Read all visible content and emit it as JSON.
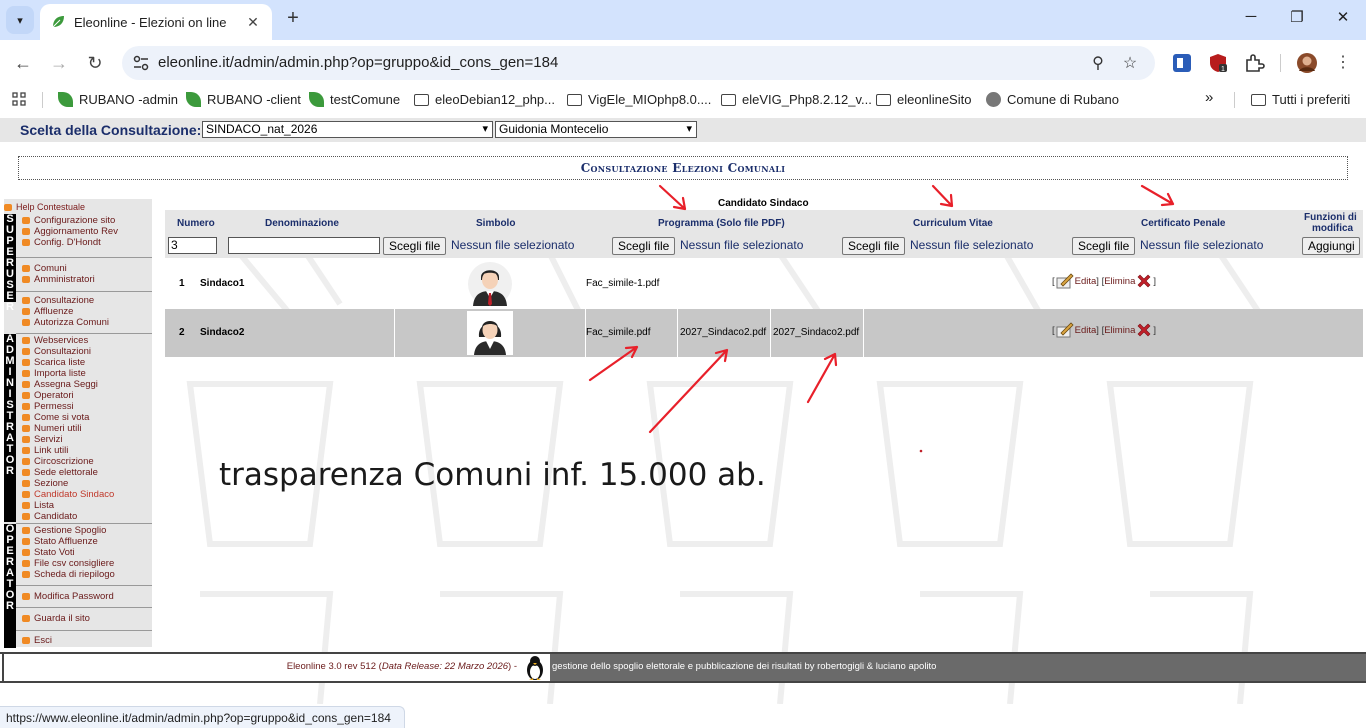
{
  "browser": {
    "tab_title": "Eleonline - Elezioni on line",
    "url": "eleonline.it/admin/admin.php?op=gruppo&id_cons_gen=184",
    "bookmarks": [
      {
        "label": "RUBANO -admin",
        "icon": "leaf-icon"
      },
      {
        "label": "RUBANO -client",
        "icon": "leaf-icon"
      },
      {
        "label": "testComune",
        "icon": "leaf-icon"
      },
      {
        "label": "eleoDebian12_php...",
        "icon": "folder-icon"
      },
      {
        "label": "VigEle_MIOphp8.0....",
        "icon": "folder-icon"
      },
      {
        "label": "eleVIG_Php8.2.12_v...",
        "icon": "folder-icon"
      },
      {
        "label": "eleonlineSito",
        "icon": "folder-icon"
      },
      {
        "label": "Comune di Rubano",
        "icon": "crest-icon"
      }
    ],
    "bookmarks_more": "»",
    "all_bookmarks": "Tutti i preferiti",
    "status_url": "https://www.eleonline.it/admin/admin.php?op=gruppo&id_cons_gen=184"
  },
  "consultation": {
    "label": "Scelta della Consultazione:",
    "selected": "SINDACO_nat_2026",
    "comune": "Guidonia Montecelio"
  },
  "page_title": "Consultazione Elezioni Comunali",
  "sidebar": {
    "help": "Help Contestuale",
    "bars": {
      "superuser": "SUPERUSER",
      "administrator": "ADMINISTRATOR",
      "operator": "OPERATOR"
    },
    "group1": [
      "Configurazione sito",
      "Aggiornamento Rev",
      "Config. D'Hondt"
    ],
    "group2": [
      "Comuni",
      "Amministratori"
    ],
    "group3": [
      "Consultazione",
      "Affluenze",
      "Autorizza Comuni"
    ],
    "group4": [
      "Webservices",
      "Consultazioni",
      "Scarica liste",
      "Importa liste",
      "Assegna Seggi",
      "Operatori",
      "Permessi",
      "Come si vota",
      "Numeri utili",
      "Servizi",
      "Link utili",
      "Circoscrizione",
      "Sede elettorale",
      "Sezione",
      "Candidato Sindaco",
      "Lista",
      "Candidato"
    ],
    "active_item": "Candidato Sindaco",
    "group5": [
      "Gestione Spoglio",
      "Stato Affluenze",
      "Stato Voti",
      "File csv consigliere",
      "Scheda di riepilogo"
    ],
    "password": "Modifica Password",
    "site": "Guarda il sito",
    "exit": "Esci"
  },
  "table": {
    "caption": "Candidato Sindaco",
    "headers": {
      "numero": "Numero",
      "denominazione": "Denominazione",
      "simbolo": "Simbolo",
      "programma": "Programma (Solo file PDF)",
      "curriculum": "Curriculum Vitae",
      "certificato": "Certificato Penale",
      "funzioni_1": "Funzioni di",
      "funzioni_2": "modifica"
    },
    "form": {
      "numero_value": "3",
      "denominazione_value": "",
      "choose_file": "Scegli file",
      "no_file": "Nessun file selezionato",
      "add_button": "Aggiungi"
    },
    "rows": [
      {
        "num": "1",
        "name": "Sindaco1",
        "avatar": "male-avatar-icon",
        "programma": "Fac_simile-1.pdf",
        "curriculum": "",
        "certificato": "",
        "edit": "Edita",
        "delete": "Elimina"
      },
      {
        "num": "2",
        "name": "Sindaco2",
        "avatar": "female-avatar-icon",
        "programma": "Fac_simile.pdf",
        "curriculum": "2027_Sindaco2.pdf",
        "certificato": "2027_Sindaco2.pdf",
        "edit": "Edita",
        "delete": "Elimina"
      }
    ]
  },
  "annotation": "trasparenza Comuni inf. 15.000 ab.",
  "footer": {
    "version": "Eleonline 3.0 rev 512",
    "release": "Data Release: 22 Marzo 2026",
    "credits": "gestione dello spoglio elettorale e pubblicazione dei risultati by robertogigli & luciano apolito"
  },
  "colors": {
    "accent": "#1b2e6b",
    "link": "#6a1a1a",
    "annotation_arrow": "#e8202a",
    "row_alt": "#c7c7c7"
  }
}
